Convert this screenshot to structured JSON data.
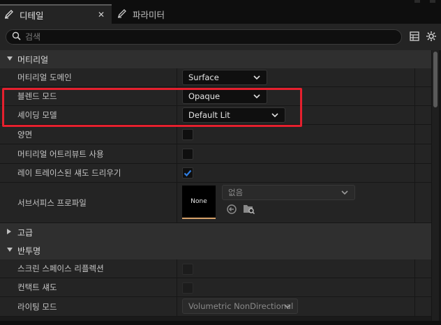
{
  "tabs": [
    {
      "label": "디테일",
      "icon": "pencil-icon",
      "active": true
    },
    {
      "label": "파라미터",
      "icon": "pencil-icon",
      "active": false
    }
  ],
  "tab_close": "✕",
  "search": {
    "placeholder": "검색",
    "value": ""
  },
  "categories": {
    "material": {
      "label": "머티리얼",
      "expanded": true
    },
    "advanced": {
      "label": "고급",
      "expanded": false
    },
    "translucency": {
      "label": "반투명",
      "expanded": true
    }
  },
  "rows": {
    "material_domain": {
      "label": "머티리얼 도메인",
      "value": "Surface"
    },
    "blend_mode": {
      "label": "블렌드 모드",
      "value": "Opaque"
    },
    "shading_model": {
      "label": "셰이딩 모델",
      "value": "Default Lit"
    },
    "two_sided": {
      "label": "양면",
      "checked": false
    },
    "use_material_attributes": {
      "label": "머티리얼 어트리뷰트 사용",
      "checked": false
    },
    "ray_traced_shadows": {
      "label": "레이 트레이스된 섀도 드리우기",
      "checked": true
    },
    "subsurface_profile": {
      "label": "서브서피스 프로파일",
      "thumb_label": "None",
      "value": "없음"
    },
    "screen_space_reflections": {
      "label": "스크린 스페이스 리플렉션",
      "checked": false
    },
    "contact_shadows": {
      "label": "컨택트 섀도",
      "checked": false
    },
    "lighting_mode": {
      "label": "라이팅 모드",
      "value": "Volumetric NonDirectional"
    }
  },
  "colors": {
    "highlight": "#e5202e",
    "check_accent": "#2f7de1",
    "thumb_accent": "#d8a36b"
  }
}
